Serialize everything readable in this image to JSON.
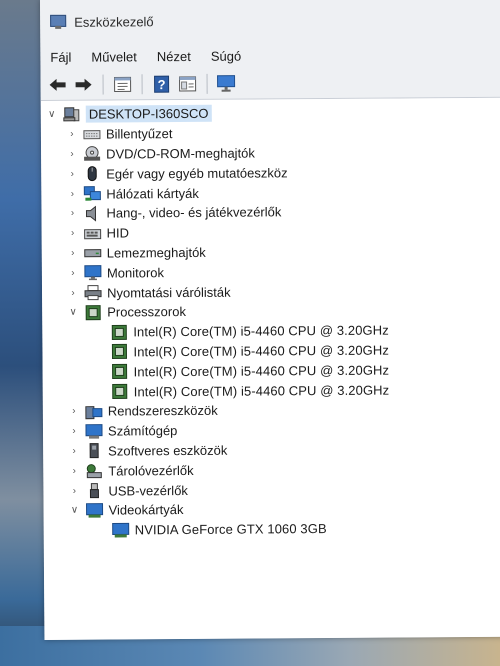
{
  "window": {
    "title": "Eszközkezelő"
  },
  "menu": [
    "Fájl",
    "Művelet",
    "Nézet",
    "Súgó"
  ],
  "toolbar": {
    "buttons": [
      "back-arrow-icon",
      "forward-arrow-icon",
      "properties-icon",
      "help-icon",
      "view-icon",
      "scan-monitor-icon"
    ]
  },
  "tree": {
    "root": "DESKTOP-I360SCO",
    "categories": [
      {
        "label": "Billentyűzet",
        "icon": "keyboard-icon",
        "expanded": false
      },
      {
        "label": "DVD/CD-ROM-meghajtók",
        "icon": "disc-drive-icon",
        "expanded": false
      },
      {
        "label": "Egér vagy egyéb mutatóeszköz",
        "icon": "mouse-icon",
        "expanded": false
      },
      {
        "label": "Hálózati kártyák",
        "icon": "network-icon",
        "expanded": false
      },
      {
        "label": "Hang-, video- és játékvezérlők",
        "icon": "speaker-icon",
        "expanded": false
      },
      {
        "label": "HID",
        "icon": "hid-icon",
        "expanded": false
      },
      {
        "label": "Lemezmeghajtók",
        "icon": "disk-drive-icon",
        "expanded": false
      },
      {
        "label": "Monitorok",
        "icon": "monitor-icon",
        "expanded": false
      },
      {
        "label": "Nyomtatási várólisták",
        "icon": "printer-icon",
        "expanded": false
      },
      {
        "label": "Processzorok",
        "icon": "processor-icon",
        "expanded": true,
        "children": [
          "Intel(R) Core(TM) i5-4460  CPU @ 3.20GHz",
          "Intel(R) Core(TM) i5-4460  CPU @ 3.20GHz",
          "Intel(R) Core(TM) i5-4460  CPU @ 3.20GHz",
          "Intel(R) Core(TM) i5-4460  CPU @ 3.20GHz"
        ]
      },
      {
        "label": "Rendszereszközök",
        "icon": "system-devices-icon",
        "expanded": false
      },
      {
        "label": "Számítógép",
        "icon": "computer-icon",
        "expanded": false
      },
      {
        "label": "Szoftveres eszközök",
        "icon": "software-device-icon",
        "expanded": false
      },
      {
        "label": "Tárolóvezérlők",
        "icon": "storage-controller-icon",
        "expanded": false
      },
      {
        "label": "USB-vezérlők",
        "icon": "usb-icon",
        "expanded": false
      },
      {
        "label": "Videokártyák",
        "icon": "display-adapter-icon",
        "expanded": true,
        "children": [
          "NVIDIA GeForce GTX 1060 3GB"
        ]
      }
    ]
  },
  "colors": {
    "selection": "#cfe3f7",
    "accent_blue": "#2f74c9",
    "toolbar_green": "#2f8a3a"
  }
}
